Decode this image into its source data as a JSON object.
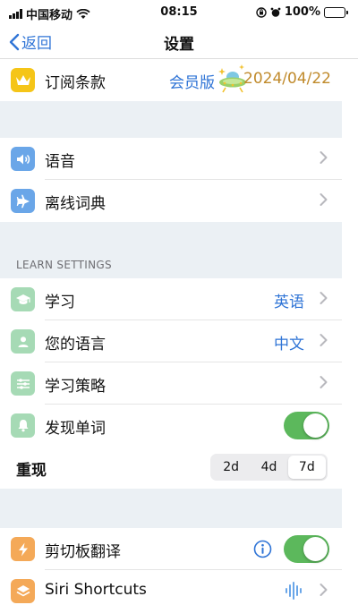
{
  "status_bar": {
    "carrier": "中国移动",
    "time": "08:15",
    "battery": "100%"
  },
  "nav": {
    "back_label": "返回",
    "title": "设置"
  },
  "subscription": {
    "label": "订阅条款",
    "tag": "会员版",
    "date": "2024/04/22"
  },
  "group1": [
    {
      "label": "语音"
    },
    {
      "label": "离线词典"
    }
  ],
  "learn_settings": {
    "header": "LEARN SETTINGS",
    "study": {
      "label": "学习",
      "value": "英语"
    },
    "your_language": {
      "label": "您的语言",
      "value": "中文"
    },
    "strategy": {
      "label": "学习策略"
    },
    "discover_words": {
      "label": "发现单词",
      "enabled": true
    },
    "reappear": {
      "label": "重现",
      "options": [
        "2d",
        "4d",
        "7d"
      ],
      "selected": "7d"
    }
  },
  "group3": {
    "clipboard": {
      "label": "剪切板翻译",
      "enabled": true
    },
    "siri": {
      "label": "Siri Shortcuts"
    }
  },
  "colors": {
    "accent": "#2f74d6",
    "toggle_on": "#5cb85c",
    "date_color": "#c08a2b",
    "section_bg": "#ebf0f4"
  }
}
